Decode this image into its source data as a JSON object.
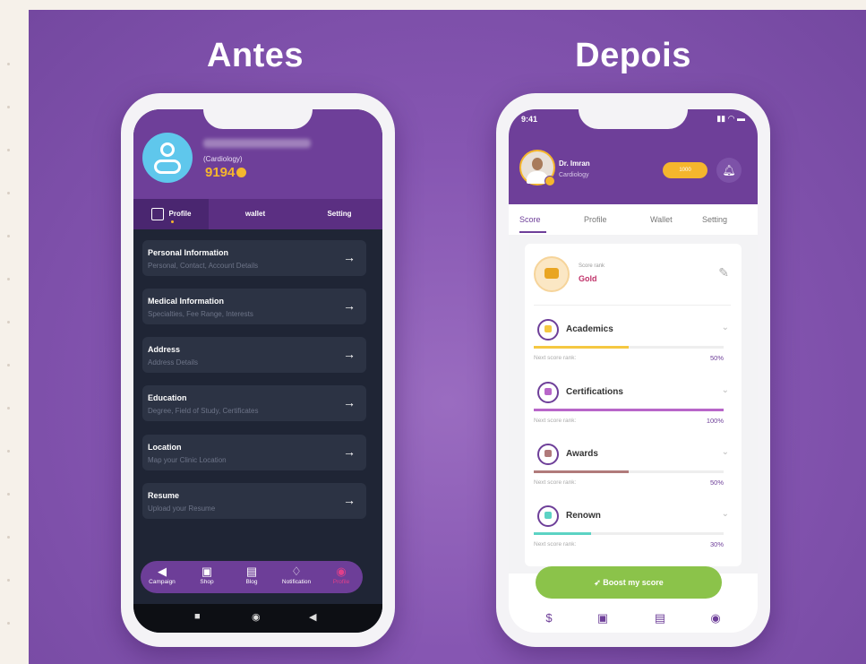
{
  "titles": {
    "before": "Antes",
    "after": "Depois"
  },
  "before": {
    "specialty": "(Cardiology)",
    "coins": "9194",
    "tabs": [
      "Profile",
      "wallet",
      "Setting"
    ],
    "items": [
      {
        "title": "Personal Information",
        "sub": "Personal, Contact, Account Details"
      },
      {
        "title": "Medical Information",
        "sub": "Specialties, Fee Range, Interests"
      },
      {
        "title": "Address",
        "sub": "Address Details"
      },
      {
        "title": "Education",
        "sub": "Degree, Field of Study, Certificates"
      },
      {
        "title": "Location",
        "sub": "Map your Clinic Location"
      },
      {
        "title": "Resume",
        "sub": "Upload your Resume"
      }
    ],
    "nav": [
      "Campaign",
      "Shop",
      "Blog",
      "Notification",
      "Profile"
    ]
  },
  "after": {
    "time": "9:41",
    "name": "Dr. Imran",
    "specialty": "Cardiology",
    "pill": "1000",
    "tabs": [
      "Score",
      "Profile",
      "Wallet",
      "Setting"
    ],
    "rank_label": "Score rank",
    "rank_value": "Gold",
    "sections": [
      {
        "name": "Academics",
        "next": "Next score rank:",
        "pct": "50%",
        "progress": 0.5,
        "color": "#f5c842"
      },
      {
        "name": "Certifications",
        "next": "Next score rank:",
        "pct": "100%",
        "progress": 1.0,
        "color": "#b866c9"
      },
      {
        "name": "Awards",
        "next": "Next score rank:",
        "pct": "50%",
        "progress": 0.5,
        "color": "#b07a7a"
      },
      {
        "name": "Renown",
        "next": "Next score rank:",
        "pct": "30%",
        "progress": 0.3,
        "color": "#5cd3c4"
      }
    ],
    "boost": "Boost my score"
  }
}
